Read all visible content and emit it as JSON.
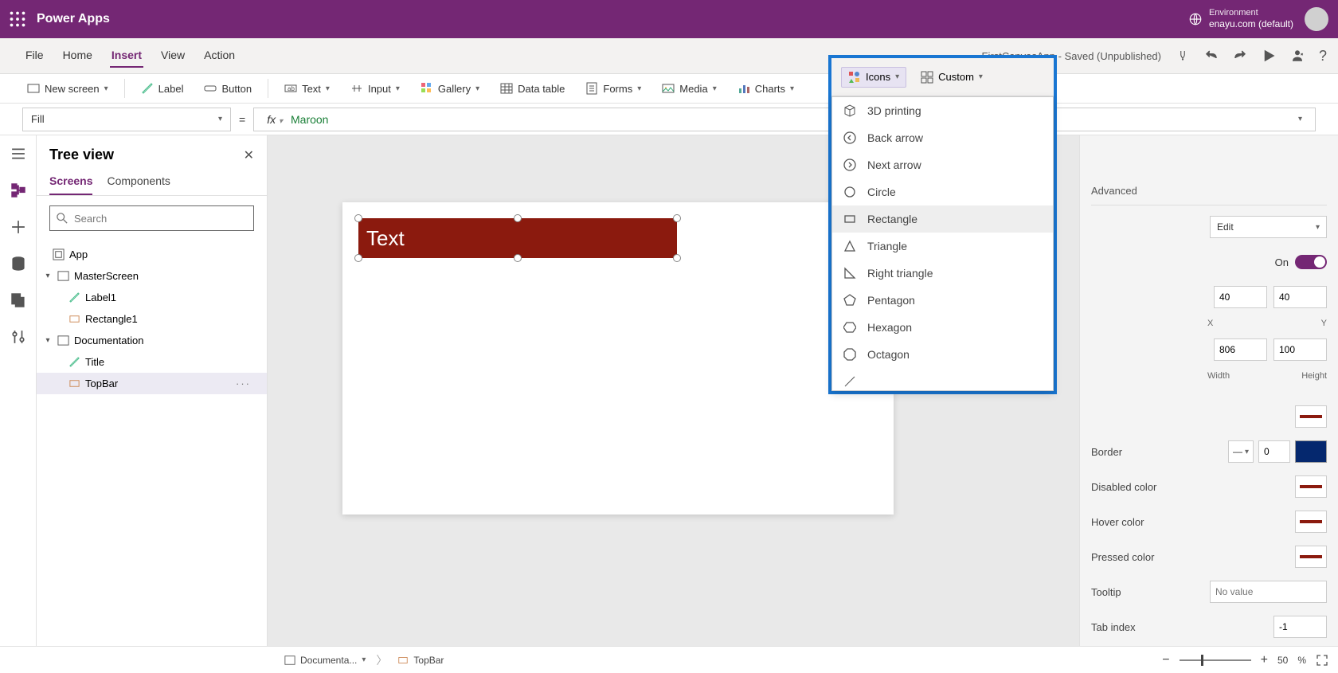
{
  "app": {
    "name": "Power Apps"
  },
  "environment": {
    "label": "Environment",
    "name": "enayu.com (default)"
  },
  "menus": {
    "file": "File",
    "home": "Home",
    "insert": "Insert",
    "view": "View",
    "action": "Action"
  },
  "doc": {
    "title": "FirstCanvasApp - Saved (Unpublished)"
  },
  "ribbon": {
    "new_screen": "New screen",
    "label": "Label",
    "button": "Button",
    "text": "Text",
    "input": "Input",
    "gallery": "Gallery",
    "data_table": "Data table",
    "forms": "Forms",
    "media": "Media",
    "charts": "Charts",
    "icons": "Icons",
    "custom": "Custom"
  },
  "formula": {
    "property": "Fill",
    "value": "Maroon"
  },
  "treeview": {
    "title": "Tree view",
    "tab_screens": "Screens",
    "tab_components": "Components",
    "search_placeholder": "Search",
    "nodes": {
      "app": "App",
      "master": "MasterScreen",
      "label1": "Label1",
      "rect1": "Rectangle1",
      "doc": "Documentation",
      "title_node": "Title",
      "topbar": "TopBar"
    }
  },
  "canvas": {
    "shape_text": "Text"
  },
  "iconmenu": {
    "items": [
      "3D printing",
      "Back arrow",
      "Next arrow",
      "Circle",
      "Rectangle",
      "Triangle",
      "Right triangle",
      "Pentagon",
      "Hexagon",
      "Octagon"
    ],
    "hovered_index": 4
  },
  "properties": {
    "tab_advanced": "Advanced",
    "display_mode": "Edit",
    "on_label": "On",
    "x": "40",
    "y": "40",
    "width": "806",
    "height": "100",
    "xl": "X",
    "yl": "Y",
    "wl": "Width",
    "hl": "Height",
    "border": "Border",
    "border_value": "0",
    "border_color": "#05286e",
    "disabled": "Disabled color",
    "hover": "Hover color",
    "pressed": "Pressed color",
    "tooltip": "Tooltip",
    "tooltip_ph": "No value",
    "tabindex": "Tab index",
    "tabindex_val": "-1",
    "swatch": "#8b1a0e"
  },
  "status": {
    "crumb_screen": "Documenta...",
    "crumb_shape": "TopBar",
    "zoom": "50",
    "zoom_unit": "%"
  }
}
